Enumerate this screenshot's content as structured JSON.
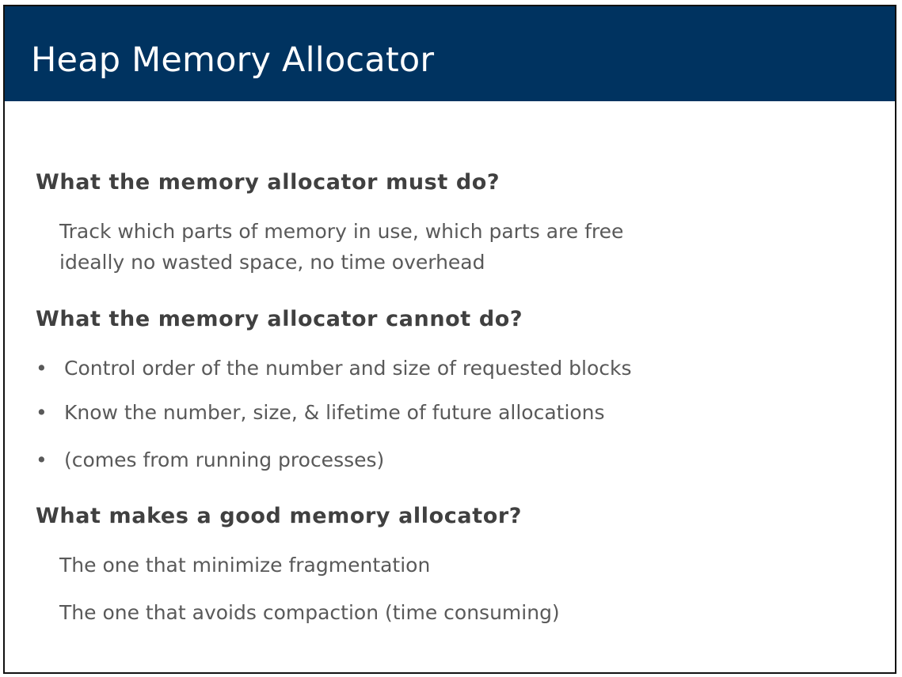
{
  "slide": {
    "title": "Heap Memory Allocator",
    "colors": {
      "title_bar": "#003360",
      "title_text": "#ffffff",
      "heading_text": "#404040",
      "body_text": "#595959"
    },
    "sections": [
      {
        "heading": "What the memory allocator must do?",
        "lines": [
          "Track which parts of memory in use, which parts are free",
          "ideally no wasted space, no time overhead"
        ]
      },
      {
        "heading": "What the memory allocator cannot do?",
        "bullet_char": "•",
        "bullets": [
          "Control order of the number and size of requested blocks",
          "Know the number, size, & lifetime of future allocations",
          "(comes from running processes)"
        ]
      },
      {
        "heading": "What makes a good memory allocator?",
        "lines": [
          "The one that minimize fragmentation",
          "The one that avoids compaction (time consuming)"
        ]
      }
    ]
  }
}
